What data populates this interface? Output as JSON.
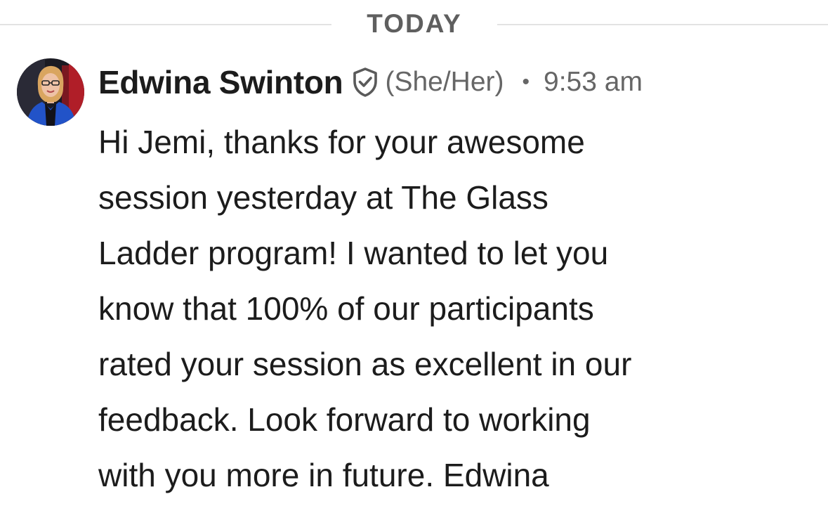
{
  "divider": {
    "label": "TODAY"
  },
  "message": {
    "sender": "Edwina Swinton",
    "verified_icon": "shield-check-icon",
    "pronouns": "(She/Her)",
    "separator": "•",
    "time": "9:53 am",
    "body_lines": [
      "Hi Jemi, thanks for your awesome",
      "session yesterday at The Glass",
      "Ladder program! I wanted to let you",
      "know that 100% of our participants",
      "rated your session as excellent in our",
      "feedback. Look forward to working",
      "with you more in future. Edwina"
    ]
  },
  "colors": {
    "text": "#1c1c1c",
    "meta": "#666666",
    "divider_line": "#e3e3e3",
    "divider_label": "#5f5f5f"
  }
}
